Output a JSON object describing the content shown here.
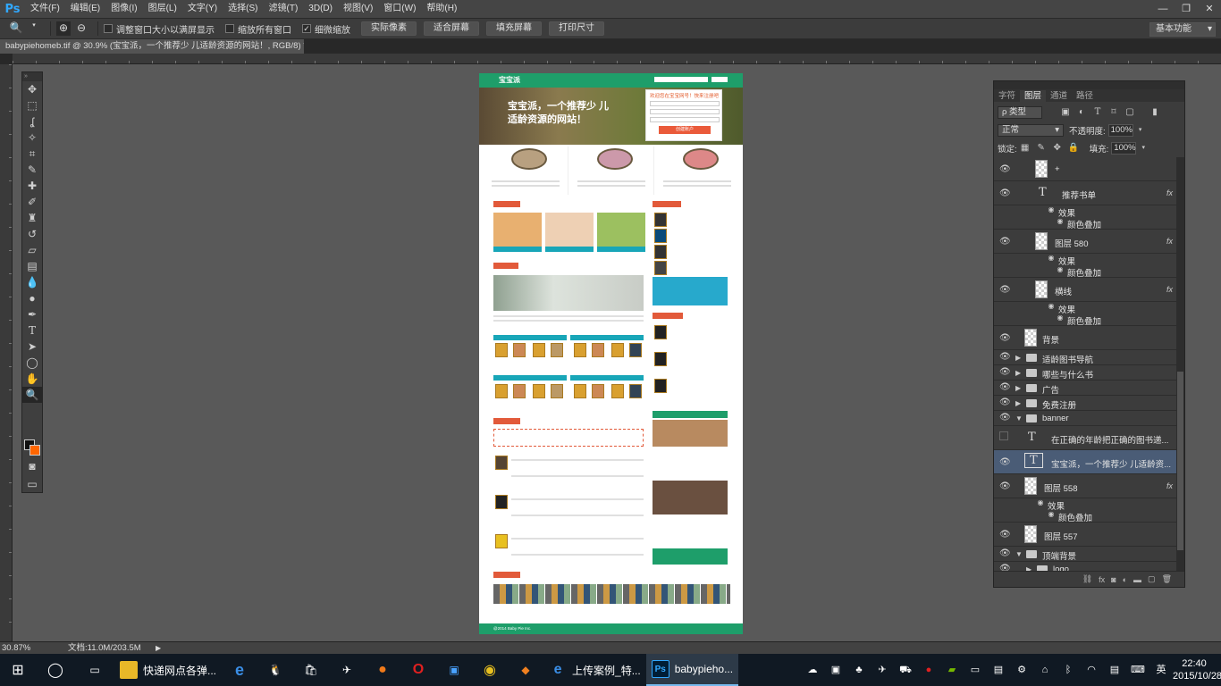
{
  "app": {
    "logo": "Ps",
    "menu": [
      "文件(F)",
      "编辑(E)",
      "图像(I)",
      "图层(L)",
      "文字(Y)",
      "选择(S)",
      "滤镜(T)",
      "3D(D)",
      "视图(V)",
      "窗口(W)",
      "帮助(H)"
    ],
    "window_controls": [
      "—",
      "❐",
      "✕"
    ]
  },
  "options": {
    "checks": [
      {
        "label": "调整窗口大小以满屏显示",
        "checked": false
      },
      {
        "label": "缩放所有窗口",
        "checked": false
      },
      {
        "label": "细微缩放",
        "checked": true
      }
    ],
    "buttons": [
      "实际像素",
      "适合屏幕",
      "填充屏幕",
      "打印尺寸"
    ],
    "workspace": "基本功能"
  },
  "document_tab": {
    "title": "babypiehomeb.tif @ 30.9% (宝宝派，一个推荐少 儿适龄资源的网站！, RGB/8) *",
    "close": "×"
  },
  "document": {
    "logo": "宝宝派",
    "banner_title": "宝宝派，一个推荐少 儿适龄资源的网站！",
    "register_title": "欢迎您在宝宝网号！快来注册吧",
    "register_button": "创建账户",
    "footer": "@2014 Baby Pie Inc."
  },
  "panels": {
    "tabs": [
      "字符",
      "图层",
      "通道",
      "路径"
    ],
    "active_tab": "图层",
    "filter_kind": "类型",
    "blend_mode": "正常",
    "opacity_label": "不透明度:",
    "opacity_value": "100%",
    "lock_label": "锁定:",
    "fill_label": "填充:",
    "fill_value": "100%",
    "layers": [
      {
        "name": "+",
        "kind": "pixel",
        "indent": 1
      },
      {
        "name": "推荐书单",
        "kind": "text",
        "indent": 1,
        "fx": true
      },
      {
        "name": "效果",
        "kind": "effect-group",
        "indent": 2
      },
      {
        "name": "颜色叠加",
        "kind": "effect",
        "indent": 3
      },
      {
        "name": "图层 580",
        "kind": "pixel",
        "indent": 1,
        "fx": true
      },
      {
        "name": "效果",
        "kind": "effect-group",
        "indent": 2
      },
      {
        "name": "颜色叠加",
        "kind": "effect",
        "indent": 3
      },
      {
        "name": "横线",
        "kind": "pixel",
        "indent": 1,
        "fx": true
      },
      {
        "name": "效果",
        "kind": "effect-group",
        "indent": 2
      },
      {
        "name": "颜色叠加",
        "kind": "effect",
        "indent": 3
      },
      {
        "name": "背景",
        "kind": "pixel",
        "indent": 0
      },
      {
        "name": "适龄图书导航",
        "kind": "folder",
        "indent": 0
      },
      {
        "name": "哪些与什么书",
        "kind": "folder",
        "indent": 0
      },
      {
        "name": "广告",
        "kind": "folder",
        "indent": 0
      },
      {
        "name": "免费注册",
        "kind": "folder",
        "indent": 0
      },
      {
        "name": "banner",
        "kind": "folder-open",
        "indent": 0
      },
      {
        "name": "在正确的年龄把正确的图书递...",
        "kind": "text",
        "indent": 1,
        "hidden": true
      },
      {
        "name": "宝宝派，一个推荐少 儿适龄资...",
        "kind": "text",
        "indent": 1,
        "selected": true
      },
      {
        "name": "图层 558",
        "kind": "pixel",
        "indent": 1,
        "fx": true
      },
      {
        "name": "效果",
        "kind": "effect-group",
        "indent": 2
      },
      {
        "name": "颜色叠加",
        "kind": "effect",
        "indent": 3
      },
      {
        "name": "图层 557",
        "kind": "pixel",
        "indent": 1
      },
      {
        "name": "顶端背景",
        "kind": "folder-open",
        "indent": 0
      },
      {
        "name": "logo",
        "kind": "folder",
        "indent": 1
      }
    ]
  },
  "status": {
    "zoom": "30.87%",
    "doc_info": "文档:11.0M/203.5M"
  },
  "taskbar": {
    "apps": [
      {
        "label": "快递网点各弹...",
        "icon": "folder-icon",
        "active": false
      },
      {
        "label": "上传案例_特...",
        "icon": "ie-icon",
        "active": false
      },
      {
        "label": "babypieho...",
        "icon": "photoshop-icon",
        "active": true
      }
    ],
    "ime": "英",
    "time": "22:40",
    "date": "2015/10/28"
  }
}
